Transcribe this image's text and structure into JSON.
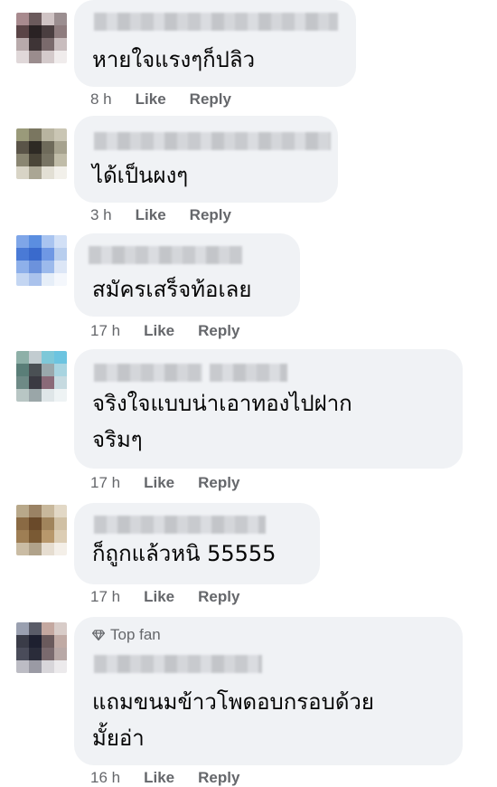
{
  "comments": [
    {
      "text_lines": [
        "หายใจแรงๆก็ปลิว"
      ],
      "time": "8 h",
      "like": "Like",
      "reply": "Reply",
      "avatar": [
        "#a88a8e",
        "#6b5a5c",
        "#cfc3c4",
        "#9b8e90",
        "#5a4446",
        "#2a2224",
        "#4a3e40",
        "#8e7c7e",
        "#b8aaab",
        "#3e3436",
        "#7a6a6c",
        "#c9bdbe",
        "#e0d8d9",
        "#9a8c8d",
        "#d4cacb",
        "#f0ecec"
      ]
    },
    {
      "text_lines": [
        "ได้เป็นผงๆ"
      ],
      "time": "3 h",
      "like": "Like",
      "reply": "Reply",
      "avatar": [
        "#9a9a7a",
        "#7a7660",
        "#b8b4a0",
        "#cac6b4",
        "#5a5448",
        "#2e2a24",
        "#6e6a5a",
        "#a6a28e",
        "#8a8672",
        "#4a4538",
        "#787464",
        "#c0bca8",
        "#d8d4c6",
        "#aaa694",
        "#e2dfd4",
        "#f2f0ea"
      ]
    },
    {
      "text_lines": [
        "สมัครเสร็จท้อเลย"
      ],
      "time": "17 h",
      "like": "Like",
      "reply": "Reply",
      "avatar": [
        "#7fa6e8",
        "#5b8ee0",
        "#a9c4f0",
        "#d2e0f6",
        "#4a7ad6",
        "#3a6acc",
        "#6f98e4",
        "#b8ceee",
        "#8eb0ea",
        "#6c92dc",
        "#9cbaec",
        "#dce6f6",
        "#c4d6f2",
        "#aac2ec",
        "#e6eef8",
        "#f4f7fc"
      ]
    },
    {
      "text_lines": [
        "จริงใจแบบน่าเอาทองไปฝาก",
        "จริมๆ"
      ],
      "time": "17 h",
      "like": "Like",
      "reply": "Reply",
      "avatar": [
        "#8eb0a8",
        "#c2ccd0",
        "#7ec8d8",
        "#6cc4e0",
        "#5a7e78",
        "#4a5054",
        "#9aa8ac",
        "#a8d4e0",
        "#6e8a86",
        "#3a3a42",
        "#8a6a78",
        "#c6dae0",
        "#b8c6c4",
        "#9aa6a8",
        "#dfe6e8",
        "#eef3f4"
      ]
    },
    {
      "text_lines": [
        "ก็ถูกแล้วหนิ 55555"
      ],
      "time": "17 h",
      "like": "Like",
      "reply": "Reply",
      "avatar": [
        "#b8a88a",
        "#9a8264",
        "#c8b89c",
        "#e2d8c6",
        "#8a6a44",
        "#6a4a2a",
        "#a0845c",
        "#d0c0a4",
        "#9e7e54",
        "#7a5a34",
        "#b8986c",
        "#dccdb4",
        "#cabca4",
        "#b0a28a",
        "#e6ddd0",
        "#f4efe8"
      ]
    },
    {
      "top_fan": "Top fan",
      "text_lines": [
        "แถมขนมข้าวโพดอบกรอบด้วย",
        "มั้ยอ่า"
      ],
      "time": "16 h",
      "like": "Like",
      "reply": "Reply",
      "avatar": [
        "#9aa0b0",
        "#5a5c68",
        "#c4a8a0",
        "#d8ccc8",
        "#3a3c48",
        "#1e2030",
        "#6a5a5c",
        "#c0aaa4",
        "#4a4c5a",
        "#2a2c3a",
        "#7a6a6e",
        "#b8a8a6",
        "#bcbcc4",
        "#9a9aa4",
        "#d8d6da",
        "#eceaec"
      ]
    }
  ],
  "colors": {
    "bubble": "#f0f2f5",
    "meta": "#65676b",
    "text": "#050505"
  }
}
